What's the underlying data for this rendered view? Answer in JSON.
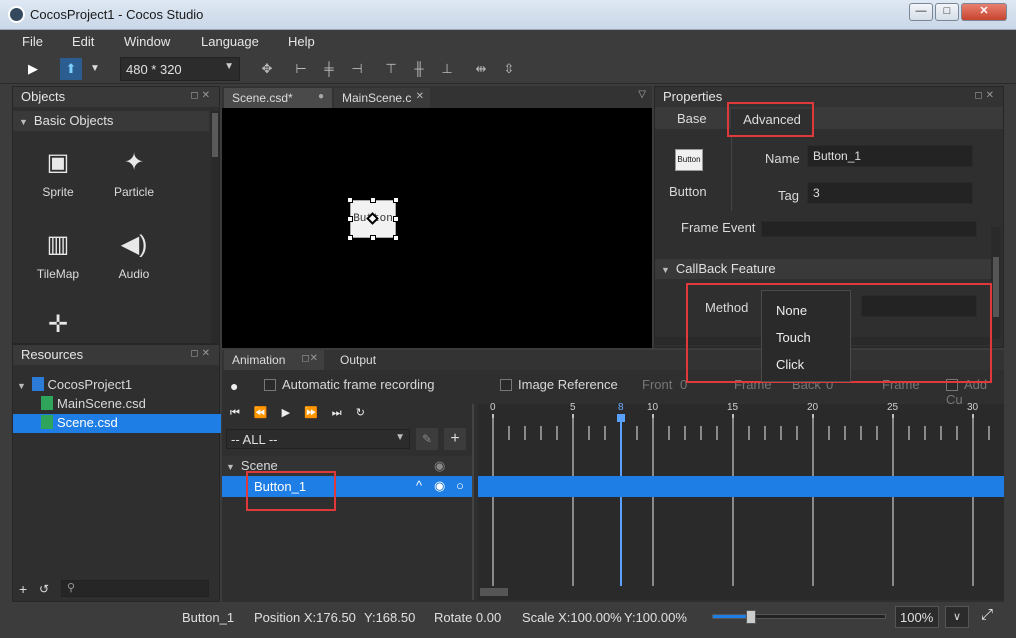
{
  "window": {
    "title": "CocosProject1 - Cocos Studio",
    "min": "—",
    "max": "□",
    "close": "✕"
  },
  "menu": [
    "File",
    "Edit",
    "Window",
    "Language",
    "Help"
  ],
  "toolbar": {
    "resolution": "480 * 320"
  },
  "objects_panel": {
    "title": "Objects",
    "section": "Basic Objects",
    "items": [
      {
        "label": "Sprite",
        "icon": "image-icon"
      },
      {
        "label": "Particle",
        "icon": "particle-icon"
      },
      {
        "label": "TileMap",
        "icon": "tilemap-icon"
      },
      {
        "label": "Audio",
        "icon": "audio-icon"
      }
    ]
  },
  "resources_panel": {
    "title": "Resources",
    "tree": [
      "CocosProject1",
      "MainScene.csd",
      "Scene.csd"
    ]
  },
  "editor_tabs": [
    "Scene.csd*",
    "MainScene.c"
  ],
  "canvas": {
    "button_text": "Button"
  },
  "properties": {
    "title": "Properties",
    "tabs": [
      "Base",
      "Advanced"
    ],
    "widget_label": "Button",
    "widget_icon_text": "Button",
    "name_label": "Name",
    "name_value": "Button_1",
    "tag_label": "Tag",
    "tag_value": "3",
    "frame_event_label": "Frame Event",
    "callback_section": "CallBack Feature",
    "method_label": "Method",
    "method_options": [
      "None",
      "Touch",
      "Click"
    ]
  },
  "animation": {
    "tabs": [
      "Animation",
      "Output"
    ],
    "auto_record": "Automatic frame recording",
    "image_reference": "Image Reference",
    "front": "Front",
    "front_val": "0",
    "frame1": "Frame",
    "back": "Back",
    "back_val": "0",
    "frame2": "Frame",
    "add": "Add Cu",
    "filter": "-- ALL --",
    "tree_root": "Scene",
    "tree_item": "Button_1",
    "ruler": [
      "0",
      "5",
      "8",
      "10",
      "15",
      "20",
      "25",
      "30"
    ],
    "current_frame": 8
  },
  "status": {
    "name": "Button_1",
    "position": "Position X:176.50",
    "y": "Y:168.50",
    "rotate": "Rotate 0.00",
    "scale_x": "Scale X:100.00%",
    "scale_y": "Y:100.00%",
    "zoom": "100%",
    "zoom_level": 0.22
  },
  "colors": {
    "accent": "#1e7ee6",
    "highlight": "#e0393b"
  }
}
